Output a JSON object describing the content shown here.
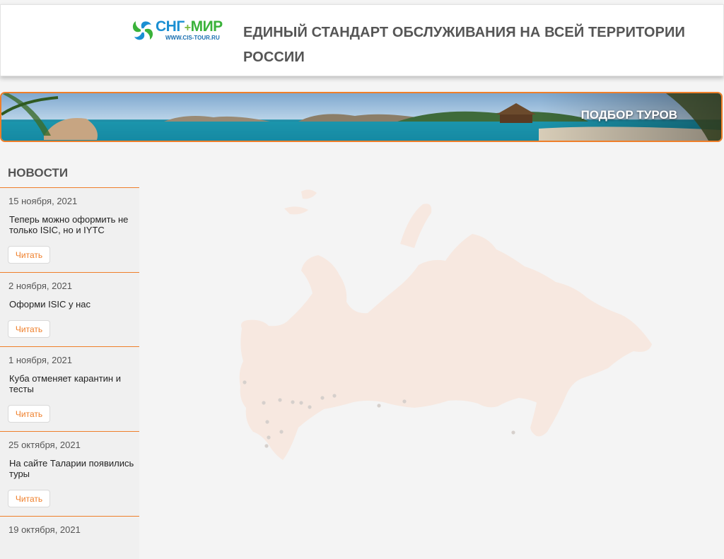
{
  "header": {
    "logo": {
      "name_part1": "СНГ",
      "name_plus": "+",
      "name_part2": "МИР",
      "url": "WWW.CIS-TOUR.RU"
    },
    "tagline": "ЕДИНЫЙ СТАНДАРТ ОБСЛУЖИВАНИЯ НА ВСЕЙ ТЕРРИТОРИИ РОССИИ"
  },
  "banner": {
    "label": "ПОДБОР ТУРОВ"
  },
  "news": {
    "title": "НОВОСТИ",
    "items": [
      {
        "date": "15 ноября, 2021",
        "text": "Теперь можно оформить не только ISIC, но и IYTC",
        "button": "Читать"
      },
      {
        "date": "2 ноября, 2021",
        "text": "Оформи ISIC у нас",
        "button": "Читать"
      },
      {
        "date": "1 ноября, 2021",
        "text": "Куба отменяет карантин и тесты",
        "button": "Читать"
      },
      {
        "date": "25 октября, 2021",
        "text": "На сайте Таларии появились туры",
        "button": "Читать"
      },
      {
        "date": "19 октября, 2021",
        "text": "",
        "button": ""
      }
    ]
  },
  "colors": {
    "accent": "#ef7f2a",
    "map_fill": "#f7e8e0",
    "background": "#f4f4f4",
    "logo_blue": "#1a8fd2",
    "logo_green": "#3ab23a"
  }
}
